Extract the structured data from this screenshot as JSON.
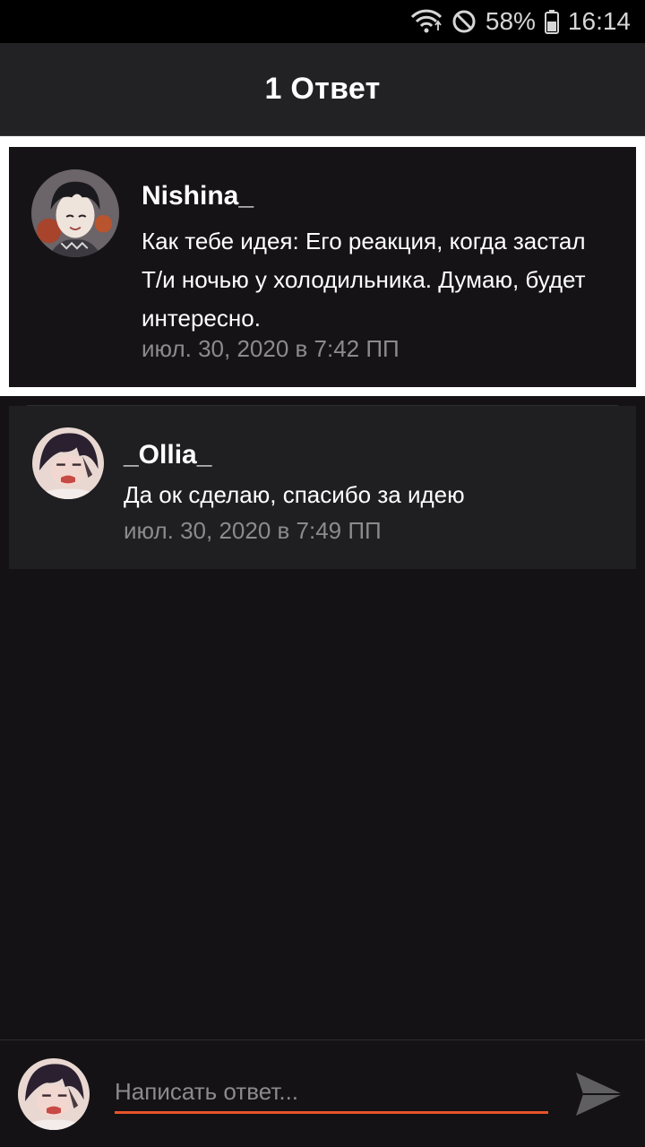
{
  "status_bar": {
    "battery_percent": "58%",
    "time": "16:14"
  },
  "header": {
    "title": "1 Ответ"
  },
  "parent_comment": {
    "author": "Nishina_",
    "text": "Как тебе идея: Его реакция, когда застал Т/и ночью у холодильника. Думаю, будет интересно.",
    "timestamp": "июл. 30, 2020 в 7:42 ПП"
  },
  "replies": [
    {
      "author": "_Ollia_",
      "text": "Да ок сделаю, спасибо за идею",
      "timestamp": "июл. 30, 2020 в 7:49 ПП"
    }
  ],
  "composer": {
    "placeholder": "Написать ответ...",
    "value": ""
  },
  "colors": {
    "accent": "#e8532a",
    "background": "#141215",
    "card": "#1f1e21",
    "muted_text": "#8b8a8d"
  },
  "icons": [
    "wifi-icon",
    "do-not-disturb-icon",
    "battery-icon",
    "send-icon"
  ]
}
